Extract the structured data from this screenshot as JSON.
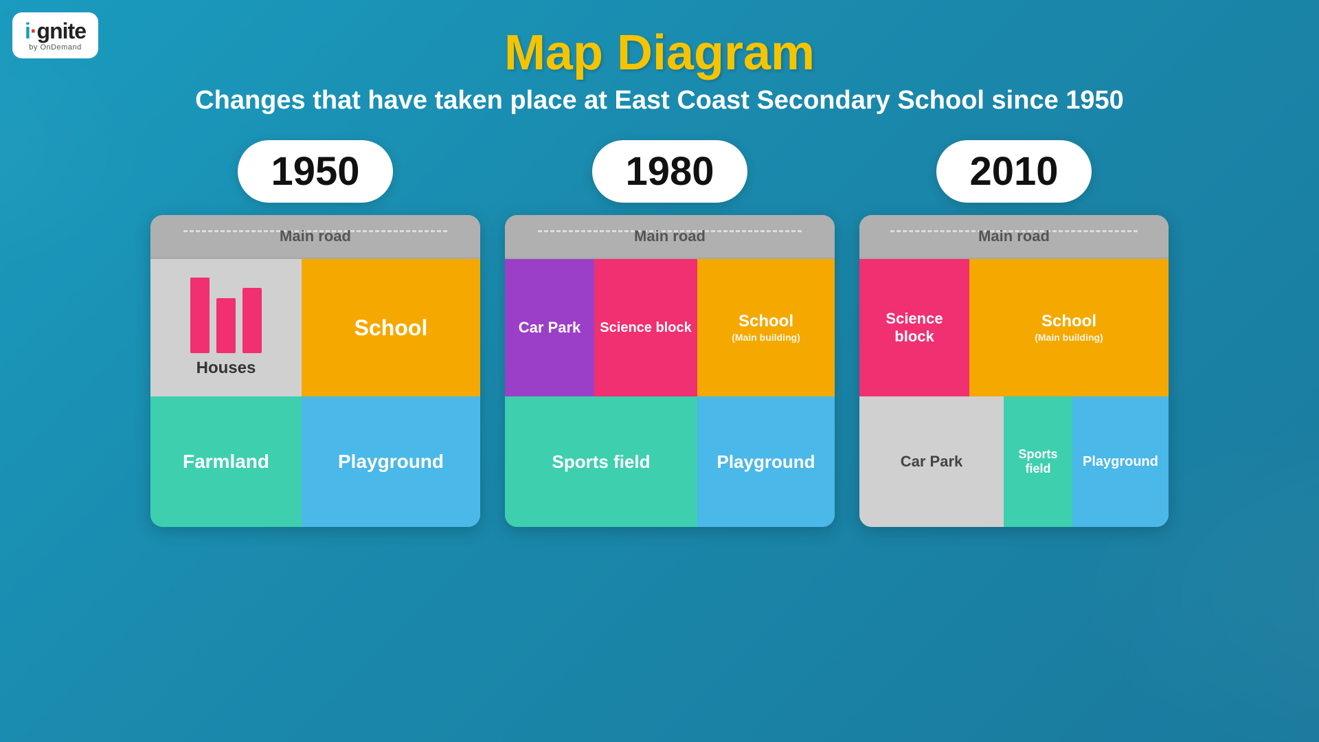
{
  "logo": {
    "brand": "ignite",
    "sub": "by OnDemand"
  },
  "header": {
    "title": "Map Diagram",
    "subtitle": "Changes that have taken place at East Coast Secondary School since 1950"
  },
  "maps": [
    {
      "year": "1950",
      "road_label": "Main road",
      "cells": {
        "houses": "Houses",
        "school": "School",
        "farmland": "Farmland",
        "playground": "Playground"
      }
    },
    {
      "year": "1980",
      "road_label": "Main road",
      "cells": {
        "carpark": "Car Park",
        "science_block": "Science block",
        "school": "School",
        "school_sub": "(Main building)",
        "sports_field": "Sports field",
        "playground": "Playground"
      }
    },
    {
      "year": "2010",
      "road_label": "Main road",
      "cells": {
        "science_block": "Science block",
        "school": "School",
        "school_sub": "(Main building)",
        "carpark": "Car Park",
        "sports_field": "Sports field",
        "playground": "Playground"
      }
    }
  ]
}
